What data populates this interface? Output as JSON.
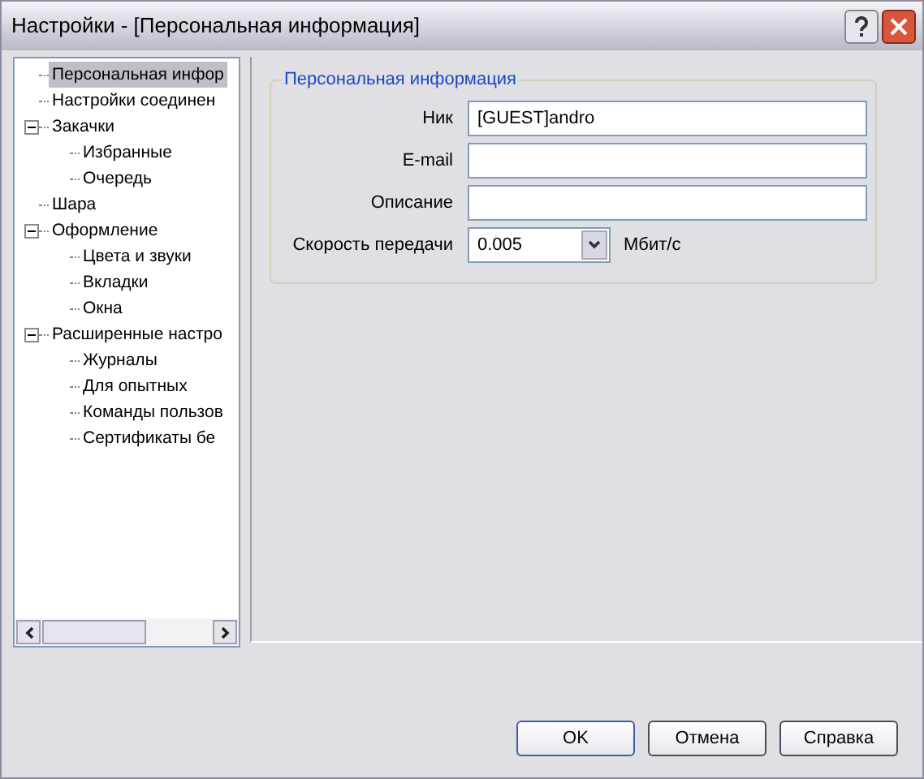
{
  "window": {
    "title": "Настройки - [Персональная информация]"
  },
  "tree": [
    {
      "label": "Персональная инфор",
      "selected": true
    },
    {
      "label": "Настройки соединен",
      "selected": false
    },
    {
      "label": "Закачки",
      "selected": false,
      "expanded": true,
      "children": [
        {
          "label": "Избранные",
          "selected": false
        },
        {
          "label": "Очередь",
          "selected": false
        }
      ]
    },
    {
      "label": "Шара",
      "selected": false
    },
    {
      "label": "Оформление",
      "selected": false,
      "expanded": true,
      "children": [
        {
          "label": "Цвета и звуки",
          "selected": false
        },
        {
          "label": "Вкладки",
          "selected": false
        },
        {
          "label": "Окна",
          "selected": false
        }
      ]
    },
    {
      "label": "Расширенные настро",
      "selected": false,
      "expanded": true,
      "children": [
        {
          "label": "Журналы",
          "selected": false
        },
        {
          "label": "Для опытных",
          "selected": false
        },
        {
          "label": "Команды пользов",
          "selected": false
        },
        {
          "label": "Сертификаты бе",
          "selected": false
        }
      ]
    }
  ],
  "group": {
    "title": "Персональная информация",
    "fields": [
      {
        "kind": "text",
        "label": "Ник",
        "value": "[GUEST]andro"
      },
      {
        "kind": "text",
        "label": "E-mail"
      },
      {
        "kind": "text",
        "label": "Описание"
      },
      {
        "kind": "combo",
        "label": "Скорость передачи",
        "value": "0.005",
        "unit": "Мбит/с"
      }
    ]
  },
  "buttons": [
    "OK",
    "Отмена",
    "Справка"
  ]
}
